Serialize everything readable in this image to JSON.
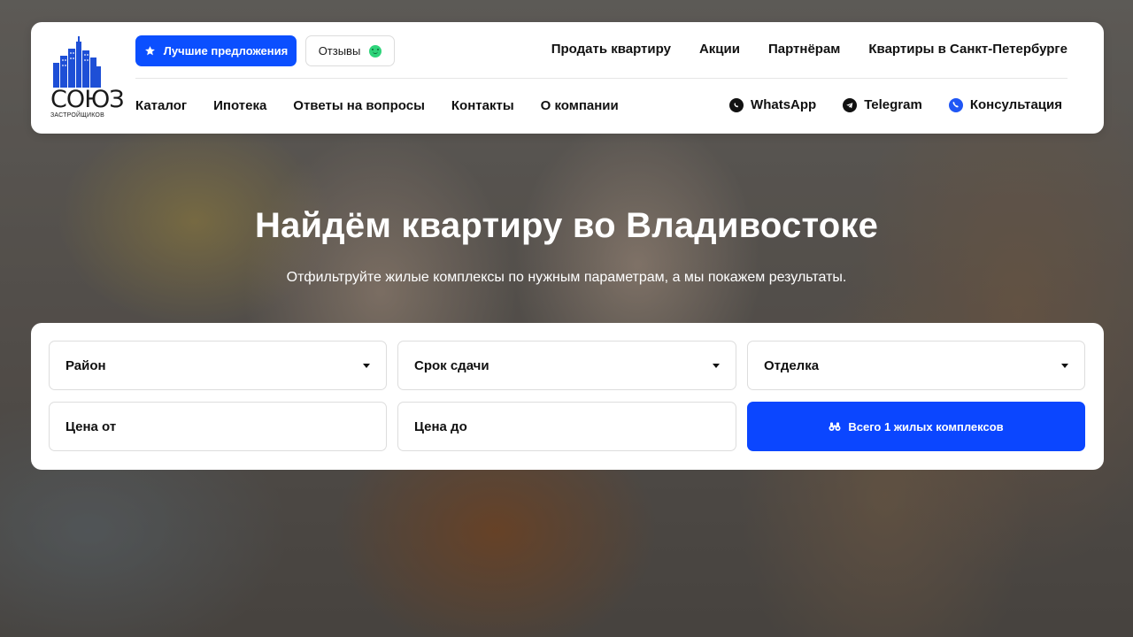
{
  "brand": {
    "logo_text": "СОЮЗ",
    "logo_sub": "ЗАСТРОЙЩИКОВ"
  },
  "header": {
    "best_offers_label": "Лучшие предложения",
    "reviews_label": "Отзывы",
    "top_links": [
      "Продать квартиру",
      "Акции",
      "Партнёрам",
      "Квартиры в Санкт-Петербурге"
    ],
    "nav": [
      "Каталог",
      "Ипотека",
      "Ответы на вопросы",
      "Контакты",
      "О компании"
    ],
    "contacts": {
      "whatsapp": "WhatsApp",
      "telegram": "Telegram",
      "consultation": "Консультация"
    }
  },
  "hero": {
    "title": "Найдём квартиру во Владивостоке",
    "subtitle": "Отфильтруйте жилые комплексы по нужным параметрам, а мы покажем результаты."
  },
  "filters": {
    "district": "Район",
    "deadline": "Срок сдачи",
    "finishing": "Отделка",
    "price_from": "Цена от",
    "price_to": "Цена до",
    "search_button": "Всего 1 жилых комплексов"
  },
  "colors": {
    "accent": "#0b4fff",
    "reviews_icon": "#2ed47a",
    "consult_icon": "#1f56f5"
  },
  "icons": {
    "best_offers": "star-icon",
    "reviews": "smile-icon",
    "whatsapp": "whatsapp-icon",
    "telegram": "telegram-icon",
    "consultation": "phone-icon",
    "search": "binoculars-icon",
    "select": "caret-down-icon"
  }
}
